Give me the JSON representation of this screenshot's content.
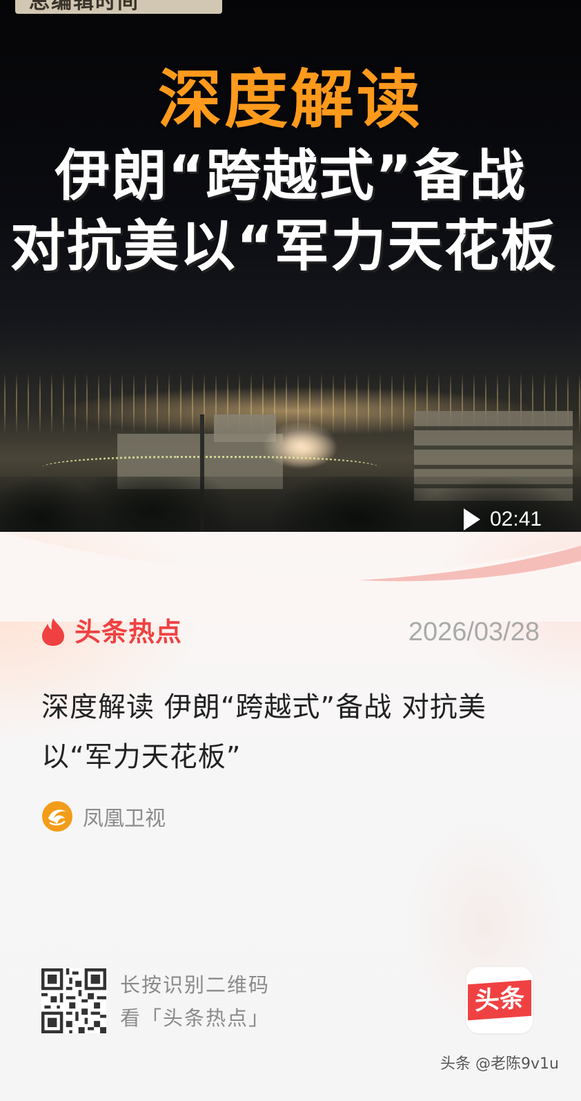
{
  "video": {
    "corner_tag": "总编辑时间",
    "headline_line1": "深度解读",
    "headline_line2": "伊朗“跨越式”备战",
    "headline_line3": "对抗美以“军力天花板",
    "duration": "02:41",
    "play_icon": "play-icon"
  },
  "card": {
    "brand_icon": "flame-icon",
    "brand_name": "头条热点",
    "date": "2026/03/28",
    "title": "深度解读 伊朗“跨越式”备战 对抗美以“军力天花板”",
    "source_icon": "phoenix-icon",
    "source_name": "凤凰卫视"
  },
  "footer": {
    "qr_line1": "长按识别二维码",
    "qr_line2": "看「头条热点」",
    "app_logo_text": "头条",
    "watermark": "头条 @老陈9v1u"
  },
  "colors": {
    "brand_red": "#f04142",
    "headline_orange": "#ff9a1c",
    "date_gray": "#a9a9a9"
  }
}
